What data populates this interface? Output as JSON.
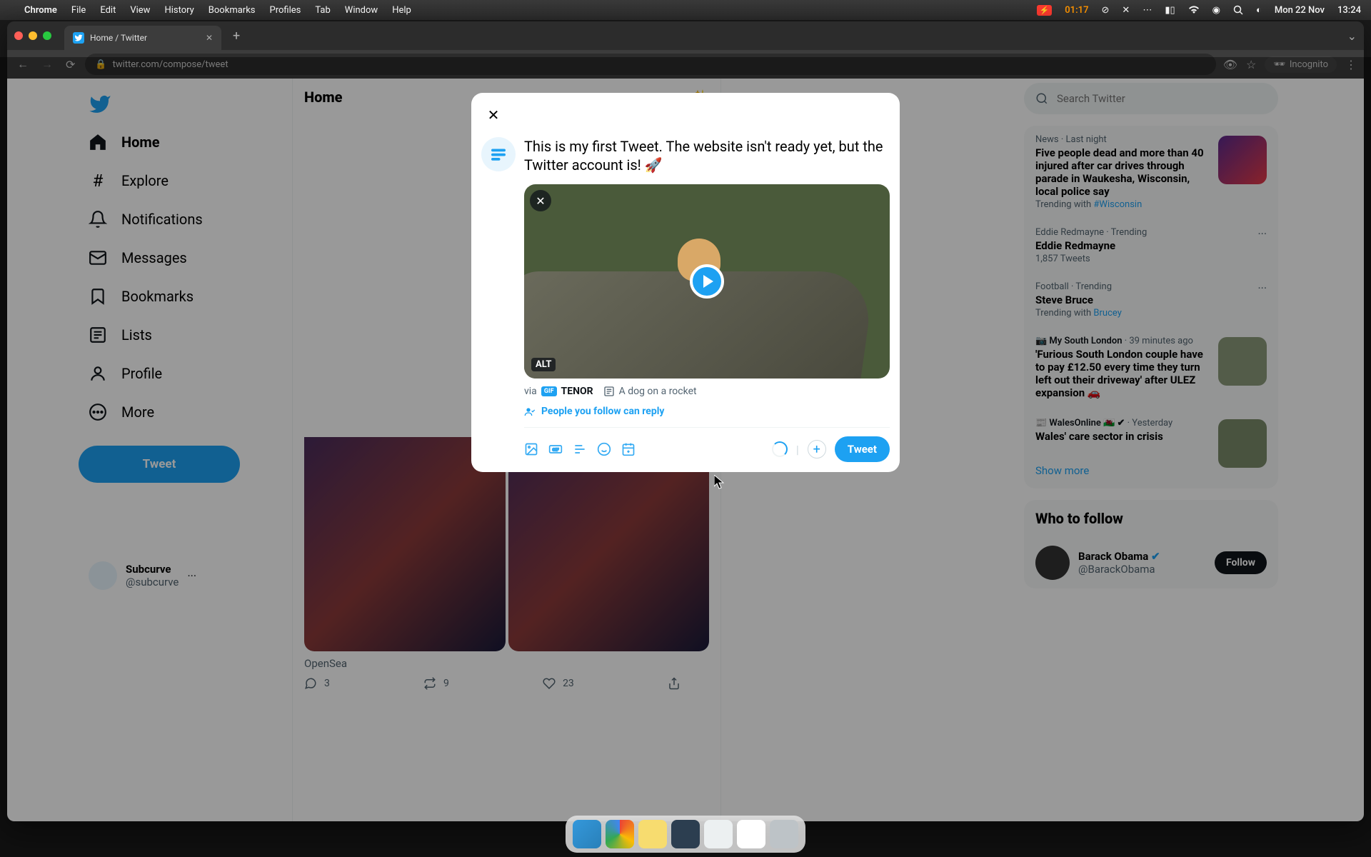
{
  "menubar": {
    "app": "Chrome",
    "items": [
      "File",
      "Edit",
      "View",
      "History",
      "Bookmarks",
      "Profiles",
      "Tab",
      "Window",
      "Help"
    ],
    "battery_time": "01:17",
    "date": "Mon 22 Nov",
    "time": "13:24"
  },
  "browser": {
    "tab_title": "Home / Twitter",
    "url": "twitter.com/compose/tweet",
    "incognito": "Incognito"
  },
  "nav": {
    "home": "Home",
    "explore": "Explore",
    "notifications": "Notifications",
    "messages": "Messages",
    "bookmarks": "Bookmarks",
    "lists": "Lists",
    "profile": "Profile",
    "more": "More",
    "tweet": "Tweet",
    "user_name": "Subcurve",
    "user_handle": "@subcurve"
  },
  "main": {
    "header": "Home",
    "feed_src": "OpenSea",
    "reply_count": "3",
    "retweet_count": "9",
    "like_count": "23"
  },
  "search": {
    "placeholder": "Search Twitter"
  },
  "trends": [
    {
      "context": "News · Last night",
      "title": "Five people dead and more than 40 injured after car drives through parade in Waukesha, Wisconsin, local police say",
      "sub_prefix": "Trending with ",
      "sub_link": "#Wisconsin",
      "thumb": true
    },
    {
      "context": "Eddie Redmayne · Trending",
      "title": "Eddie Redmayne",
      "sub": "1,857 Tweets",
      "dots": true
    },
    {
      "context": "Football · Trending",
      "title": "Steve Bruce",
      "sub_prefix": "Trending with ",
      "sub_link": "Brucey",
      "dots": true
    },
    {
      "context_src": "📷 My South London",
      "context_time": "39 minutes ago",
      "title": "'Furious South London couple have to pay £12.50 every time they turn left out their driveway' after ULEZ expansion 🚗",
      "thumb": true
    },
    {
      "context_src": "📰 WalesOnline 🏴󠁧󠁢󠁷󠁬󠁳󠁿 ✔",
      "context_time": "Yesterday",
      "title": "Wales' care sector in crisis",
      "thumb": true
    }
  ],
  "trends_show_more": "Show more",
  "follow": {
    "header": "Who to follow",
    "name": "Barack Obama",
    "handle": "@BarackObama",
    "button": "Follow"
  },
  "compose": {
    "text": "This is my first Tweet. The website isn't ready yet, but the Twitter account is! 🚀",
    "alt_badge": "ALT",
    "via": "via",
    "source": "TENOR",
    "alt_text": "A dog on a rocket",
    "reply_setting": "People you follow can reply",
    "submit": "Tweet"
  }
}
